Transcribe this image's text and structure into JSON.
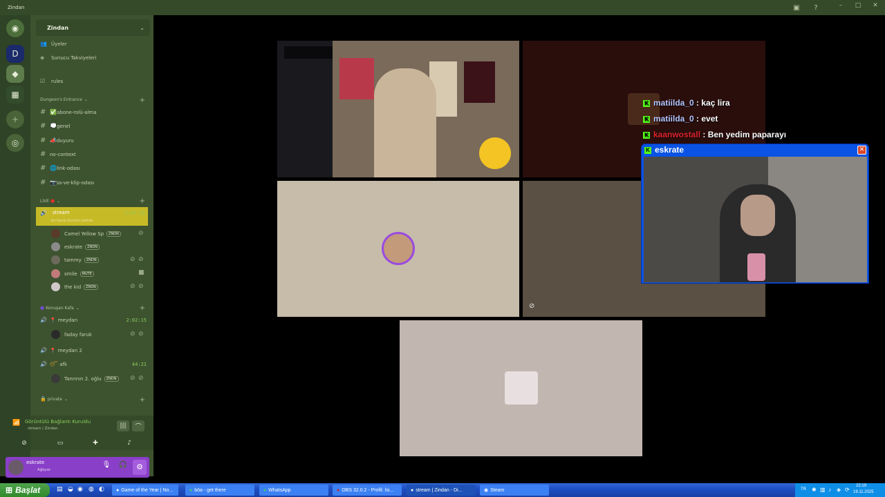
{
  "window": {
    "title": "Zindan"
  },
  "server": {
    "name": "Zindan"
  },
  "sidebar_top": [
    {
      "label": "Üyeler"
    },
    {
      "label": "Sunucu Takviyeleri"
    },
    {
      "label": "rules"
    }
  ],
  "category_dungeon": "Dungeon's Entrance",
  "text_channels": [
    {
      "label": "abone-rolü-alma",
      "icon": "✅"
    },
    {
      "label": "genel",
      "icon": "💭"
    },
    {
      "label": "duyuru",
      "icon": "📣"
    },
    {
      "label": "no-context",
      "icon": ""
    },
    {
      "label": "link-odası",
      "icon": "🌐"
    },
    {
      "label": "ss-ve-klip-odası",
      "icon": "📷"
    }
  ],
  "category_live": "LIVE",
  "stream_channel": {
    "label": "stream",
    "time": "1:57:25",
    "status": "bir kanal durumu belirle"
  },
  "stream_users": [
    {
      "name": "Camel Yellow Sp",
      "tag": "ZNDN"
    },
    {
      "name": "eskrate",
      "tag": "ZNDN"
    },
    {
      "name": "tammy",
      "tag": "ZNDN"
    },
    {
      "name": "smile",
      "tag": "MUTE"
    },
    {
      "name": "the kid",
      "tag": "ZNDN"
    }
  ],
  "category_talk": "Konuşan Kafa",
  "voice_channels": [
    {
      "label": "meydan",
      "time": "2:02:15"
    },
    {
      "label": "meydan 2",
      "time": ""
    },
    {
      "label": "afk",
      "time": "44:21"
    }
  ],
  "meydan_user": {
    "name": "faday faruk"
  },
  "afk_user": {
    "name": "Tanrının 2. oğlu",
    "tag": "ZNDN"
  },
  "category_private": "private",
  "connection": {
    "status": "Görüntülü Bağlantı Kuruldu",
    "location": "stream / Zindan"
  },
  "current_user": {
    "name": "eskrate",
    "status": "Ağlıyor"
  },
  "chat": [
    {
      "user": "matiilda_0",
      "message": " : kaç lira",
      "color": "#b8c6ff"
    },
    {
      "user": "matiilda_0",
      "message": " : evet",
      "color": "#b8c6ff"
    },
    {
      "user": "kaanwostall",
      "message": " : Ben yedim paparayı",
      "color": "#e2242e"
    }
  ],
  "cam_window": {
    "title": "eskrate"
  },
  "taskbar": {
    "start": "Başlat",
    "tasks": [
      {
        "label": "Game of the Year | No..."
      },
      {
        "label": "böa - get there"
      },
      {
        "label": "WhatsApp"
      },
      {
        "label": "OBS 32.0.2 - Profil: İsi..."
      },
      {
        "label": "stream | Zindan - Di..."
      },
      {
        "label": "Steam"
      }
    ],
    "lang": "TR",
    "time": "22:19",
    "date": "19.11.2025"
  },
  "colors": {
    "accent": "#c7ba27",
    "sidebar": "#3d5330",
    "kick": "#53fc18"
  }
}
